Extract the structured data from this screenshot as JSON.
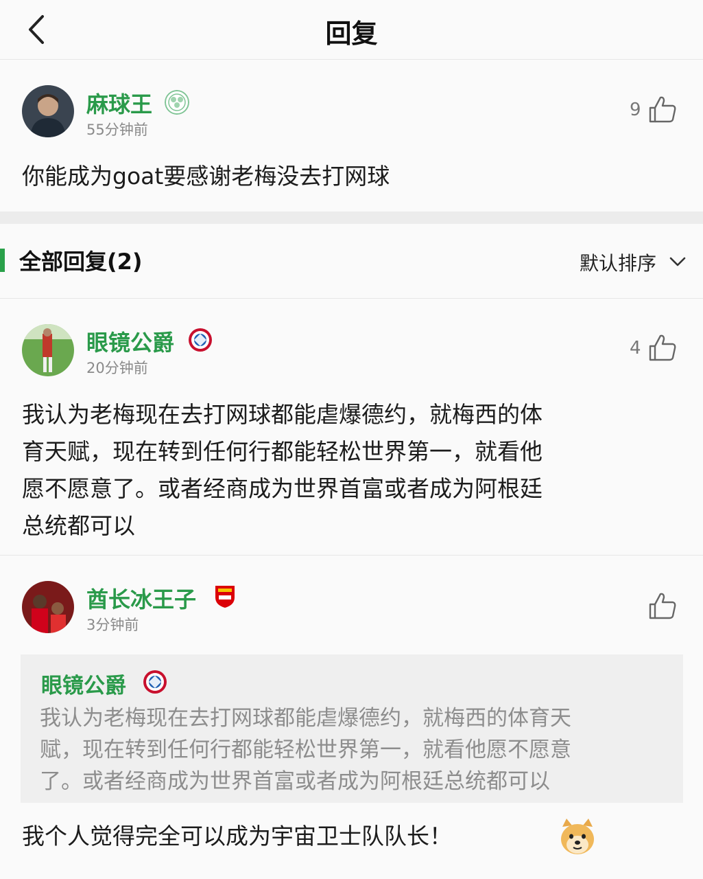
{
  "header": {
    "title": "回复"
  },
  "main_comment": {
    "username": "麻球王",
    "time": "55分钟前",
    "likes": "9",
    "text": "你能成为goat要感谢老梅没去打网球",
    "badge_icon": "celtic-badge-icon"
  },
  "section": {
    "title": "全部回复(2)",
    "sort_label": "默认排序"
  },
  "replies": [
    {
      "username": "眼镜公爵",
      "time": "20分钟前",
      "likes": "4",
      "lines": [
        "我认为老梅现在去打网球都能虐爆德约，就梅西的体",
        "育天赋，现在转到任何行都能轻松世界第一，就看他",
        "愿不愿意了。或者经商成为世界首富或者成为阿根廷",
        "总统都可以"
      ],
      "badge_icon": "bayern-badge-icon"
    },
    {
      "username": "酋长冰王子",
      "time": "3分钟前",
      "likes": "",
      "badge_icon": "arsenal-badge-icon",
      "quote": {
        "username": "眼镜公爵",
        "lines": [
          "我认为老梅现在去打网球都能虐爆德约，就梅西的体育天",
          "赋，现在转到任何行都能轻松世界第一，就看他愿不愿意",
          "了。或者经商成为世界首富或者成为阿根廷总统都可以"
        ]
      },
      "text": "我个人觉得完全可以成为宇宙卫士队队长！"
    }
  ],
  "colors": {
    "accent": "#2a9a4a",
    "section_bar": "#2aa14a"
  }
}
